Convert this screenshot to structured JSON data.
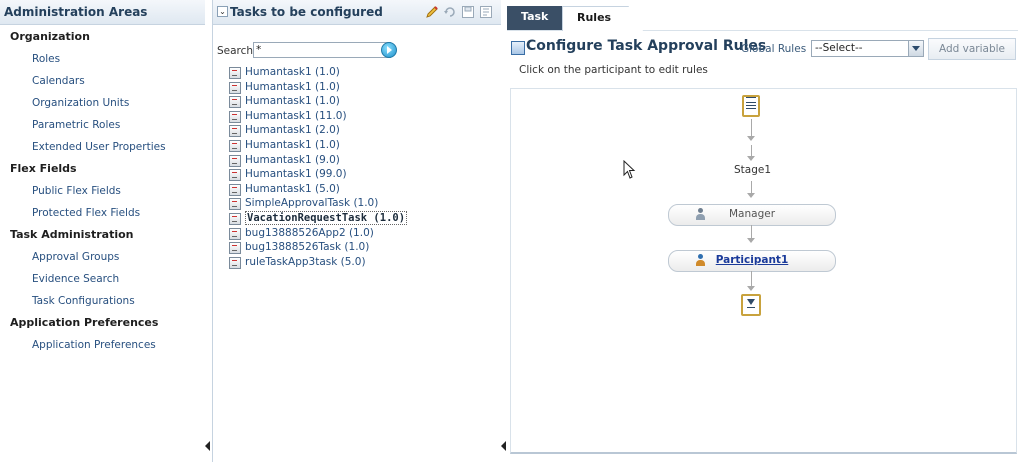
{
  "admin": {
    "title": "Administration Areas",
    "groups": [
      {
        "label": "Organization",
        "items": [
          "Roles",
          "Calendars",
          "Organization Units",
          "Parametric Roles",
          "Extended User Properties"
        ]
      },
      {
        "label": "Flex Fields",
        "items": [
          "Public Flex Fields",
          "Protected Flex Fields"
        ]
      },
      {
        "label": "Task Administration",
        "items": [
          "Approval Groups",
          "Evidence Search",
          "Task Configurations"
        ]
      },
      {
        "label": "Application Preferences",
        "items": [
          "Application Preferences"
        ]
      }
    ]
  },
  "tasks_panel": {
    "title": "Tasks to be configured",
    "search_label": "Search",
    "search_value": "*",
    "tasks": [
      "Humantask1 (1.0)",
      "Humantask1 (1.0)",
      "Humantask1 (1.0)",
      "Humantask1 (11.0)",
      "Humantask1 (2.0)",
      "Humantask1 (1.0)",
      "Humantask1 (9.0)",
      "Humantask1 (99.0)",
      "Humantask1 (5.0)",
      "SimpleApprovalTask (1.0)",
      "VacationRequestTask (1.0)",
      "bug13888526App2 (1.0)",
      "bug13888526Task (1.0)",
      "ruleTaskApp3task (5.0)"
    ],
    "selected_task": "VacationRequestTask (1.0)"
  },
  "right_panel": {
    "tabs": [
      "Task",
      "Rules"
    ],
    "active_tab": "Rules",
    "title": "Configure Task Approval Rules",
    "global_rules_label": "Global Rules",
    "global_rules_value": "--Select--",
    "add_variable_label": "Add variable",
    "hint": "Click on the participant to edit rules",
    "flow": {
      "stage_label": "Stage1",
      "participants": [
        "Manager",
        "Participant1"
      ],
      "active_participant": "Participant1"
    }
  },
  "colors": {
    "header_text": "#24405c",
    "link": "#274f7f",
    "tab_active_bg": "#3a4f66",
    "node_border": "#c8a23d"
  }
}
